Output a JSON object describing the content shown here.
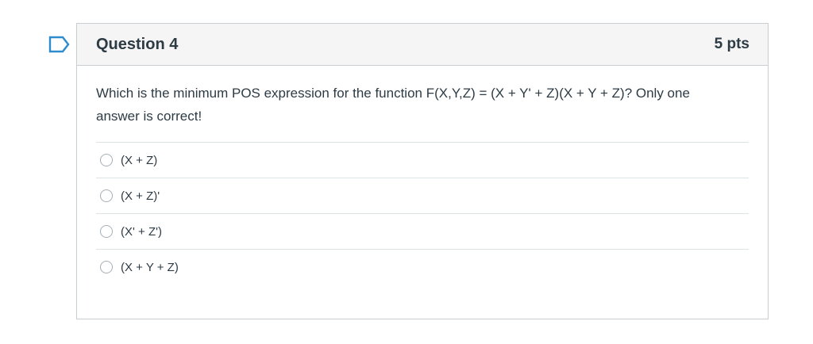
{
  "question": {
    "title": "Question 4",
    "points": "5 pts",
    "text": "Which is the minimum POS expression for the function F(X,Y,Z) = (X + Y' + Z)(X + Y + Z)? Only one answer is correct!",
    "answers": [
      {
        "label": "(X + Z)",
        "selected": false
      },
      {
        "label": "(X + Z)'",
        "selected": false
      },
      {
        "label": "(X' + Z')",
        "selected": false
      },
      {
        "label": "(X + Y + Z)",
        "selected": false
      }
    ]
  },
  "colors": {
    "bookmark": "#2d8bce",
    "header_bg": "#f5f5f5",
    "border": "#c7cdd1",
    "text": "#2d3b45"
  },
  "icons": {
    "bookmark": "bookmark-icon"
  }
}
